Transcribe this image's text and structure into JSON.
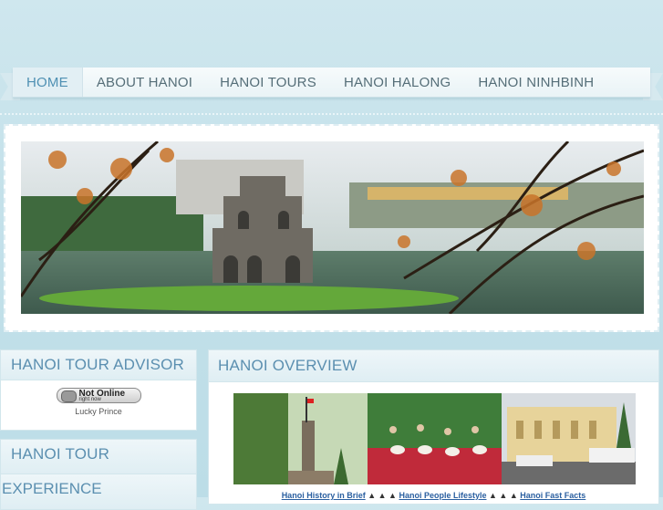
{
  "nav": {
    "items": [
      {
        "label": "HOME",
        "active": true
      },
      {
        "label": "ABOUT HANOI",
        "active": false
      },
      {
        "label": "HANOI TOURS",
        "active": false
      },
      {
        "label": "HANOI HALONG",
        "active": false
      },
      {
        "label": "HANOI NINHBINH",
        "active": false
      }
    ]
  },
  "sidebar": {
    "advisor_title": "HANOI TOUR ADVISOR",
    "status_main": "Not Online",
    "status_sub": "right now",
    "advisor_name": "Lucky Prince",
    "experience_title_1": "HANOI TOUR",
    "experience_title_2": "EXPERIENCE"
  },
  "overview": {
    "title": "HANOI OVERVIEW",
    "links": [
      "Hanoi History in Brief",
      "Hanoi People Lifestyle",
      "Hanoi Fast Facts"
    ],
    "separator": "▲ ▲ ▲"
  },
  "colors": {
    "accent": "#5b8fb0",
    "background": "#c4e1ea"
  }
}
